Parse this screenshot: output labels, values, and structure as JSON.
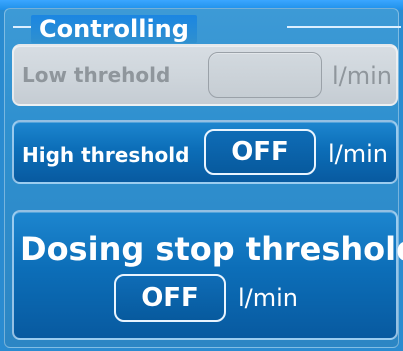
{
  "panel": {
    "title": "Controlling"
  },
  "rows": {
    "low_threshold": {
      "label": "Low threhold",
      "value": "",
      "unit": "l/min",
      "enabled": false
    },
    "high_threshold": {
      "label": "High threshold",
      "value": "OFF",
      "unit": "l/min",
      "enabled": true
    },
    "dosing_stop_threshold": {
      "label": "Dosing stop threshold",
      "value": "OFF",
      "unit": "l/min",
      "enabled": true
    }
  },
  "colors": {
    "background": "#2a8bd0",
    "button_blue": "#0c6eb8",
    "disabled_gray": "#cfd6dc",
    "text_white": "#ffffff",
    "disabled_text": "#8f969c"
  }
}
